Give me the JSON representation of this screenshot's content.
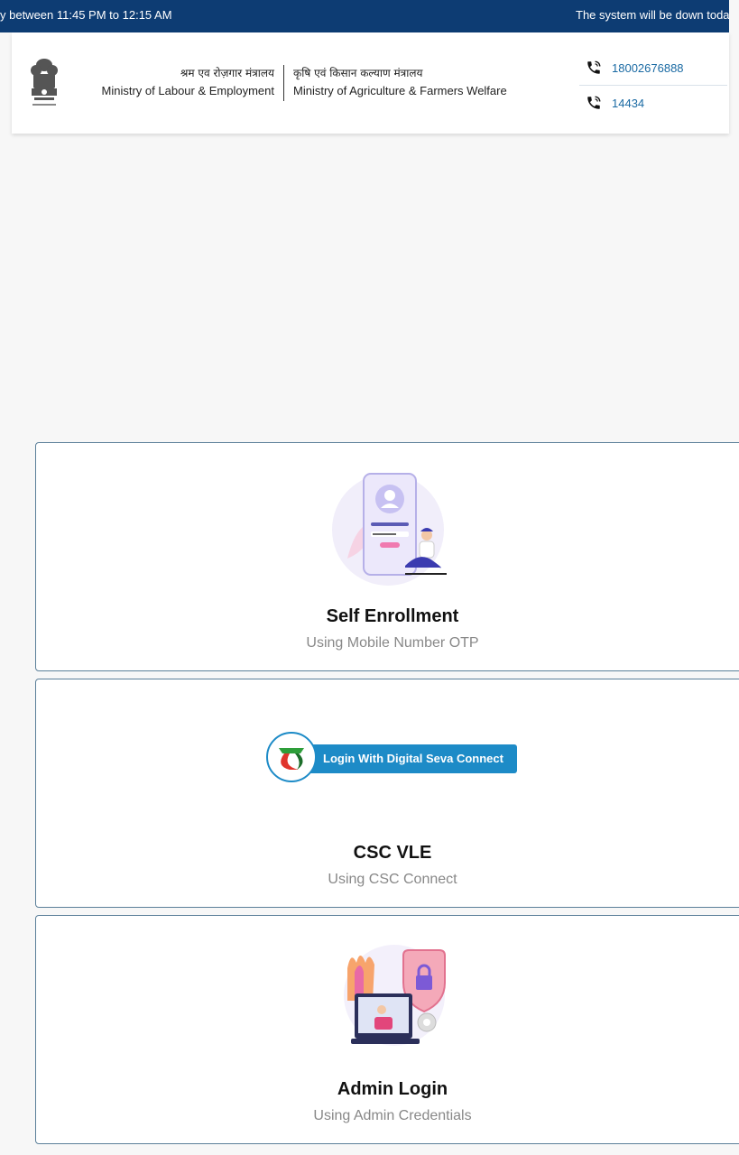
{
  "ticker": {
    "text_left": "y between 11:45 PM to 12:15 AM",
    "text_right": "The system will be down toda"
  },
  "header": {
    "ministry_labour_hindi": "श्रम एव रोज़गार मंत्रालय",
    "ministry_labour": "Ministry of Labour & Employment",
    "ministry_agri_hindi": "कृषि एवं किसान कल्याण मंत्रालय",
    "ministry_agri": "Ministry of Agriculture & Farmers Welfare",
    "phones": [
      "18002676888",
      "14434"
    ]
  },
  "cards": [
    {
      "title": "Self Enrollment",
      "subtitle": "Using Mobile Number OTP",
      "icon": "person-phone-illustration"
    },
    {
      "title": "CSC VLE",
      "subtitle": "Using CSC Connect",
      "button_label": "Login With Digital Seva Connect",
      "icon": "digital-seva-logo"
    },
    {
      "title": "Admin Login",
      "subtitle": "Using Admin Credentials",
      "icon": "admin-lock-illustration"
    }
  ],
  "colors": {
    "ticker_bg": "#0d3c73",
    "link": "#1a6aa3",
    "card_border": "#5b7f99",
    "csc_button": "#1d8bc7"
  }
}
